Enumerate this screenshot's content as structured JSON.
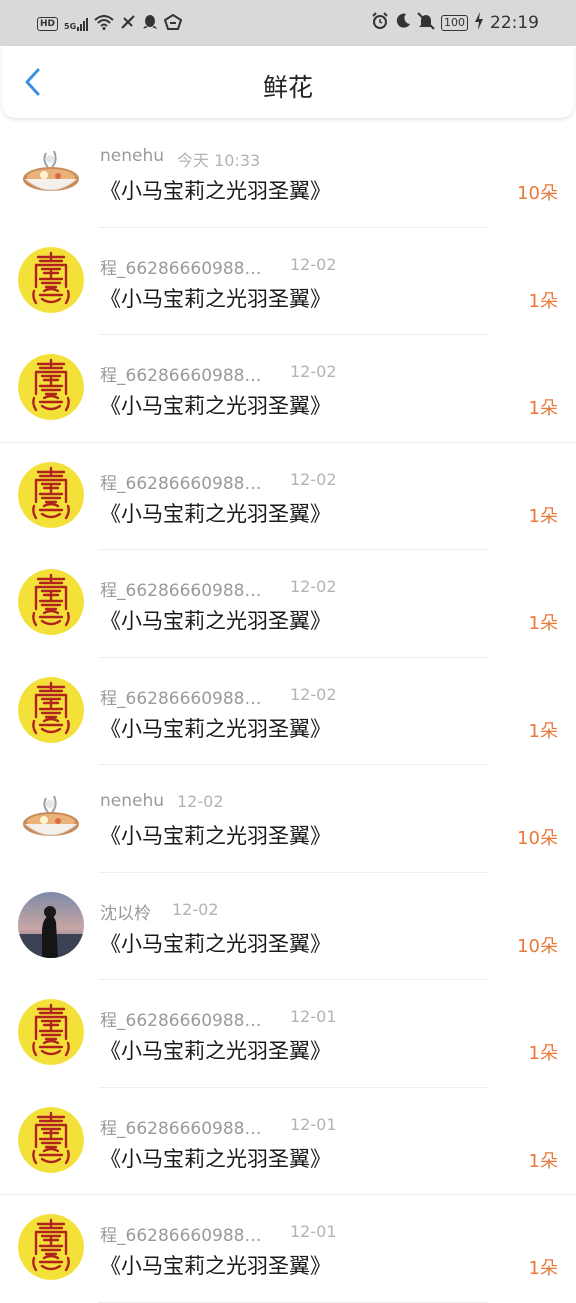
{
  "status_bar": {
    "left_icons": [
      "hd-icon",
      "5g-signal-icon",
      "wifi-icon",
      "vibrate-icon",
      "qq-icon",
      "app-icon"
    ],
    "battery": "100",
    "time": "22:19",
    "right_icons": [
      "alarm-icon",
      "moon-icon",
      "mute-icon",
      "battery-icon",
      "charging-icon"
    ]
  },
  "nav": {
    "title": "鲜花",
    "back_icon": "chevron-left-icon",
    "accent": "#3d8fe0"
  },
  "colors": {
    "count": "#e8793a",
    "name": "#9a9a9a"
  },
  "items": [
    {
      "name": "nenehu",
      "date": "今天 10:33",
      "book": "《小马宝莉之光羽圣翼》",
      "count": "10朵",
      "avatar": "noodle"
    },
    {
      "name": "程_662866609884...",
      "date": "12-02",
      "book": "《小马宝莉之光羽圣翼》",
      "count": "1朵",
      "avatar": "talisman"
    },
    {
      "name": "程_662866609884...",
      "date": "12-02",
      "book": "《小马宝莉之光羽圣翼》",
      "count": "1朵",
      "avatar": "talisman"
    },
    {
      "name": "程_662866609884...",
      "date": "12-02",
      "book": "《小马宝莉之光羽圣翼》",
      "count": "1朵",
      "avatar": "talisman"
    },
    {
      "name": "程_662866609884...",
      "date": "12-02",
      "book": "《小马宝莉之光羽圣翼》",
      "count": "1朵",
      "avatar": "talisman"
    },
    {
      "name": "程_662866609884...",
      "date": "12-02",
      "book": "《小马宝莉之光羽圣翼》",
      "count": "1朵",
      "avatar": "talisman"
    },
    {
      "name": "nenehu",
      "date": "12-02",
      "book": "《小马宝莉之光羽圣翼》",
      "count": "10朵",
      "avatar": "noodle"
    },
    {
      "name": "沈以柃",
      "date": "12-02",
      "book": "《小马宝莉之光羽圣翼》",
      "count": "10朵",
      "avatar": "photo"
    },
    {
      "name": "程_662866609884...",
      "date": "12-01",
      "book": "《小马宝莉之光羽圣翼》",
      "count": "1朵",
      "avatar": "talisman"
    },
    {
      "name": "程_662866609884...",
      "date": "12-01",
      "book": "《小马宝莉之光羽圣翼》",
      "count": "1朵",
      "avatar": "talisman"
    },
    {
      "name": "程_662866609884...",
      "date": "12-01",
      "book": "《小马宝莉之光羽圣翼》",
      "count": "1朵",
      "avatar": "talisman"
    }
  ]
}
